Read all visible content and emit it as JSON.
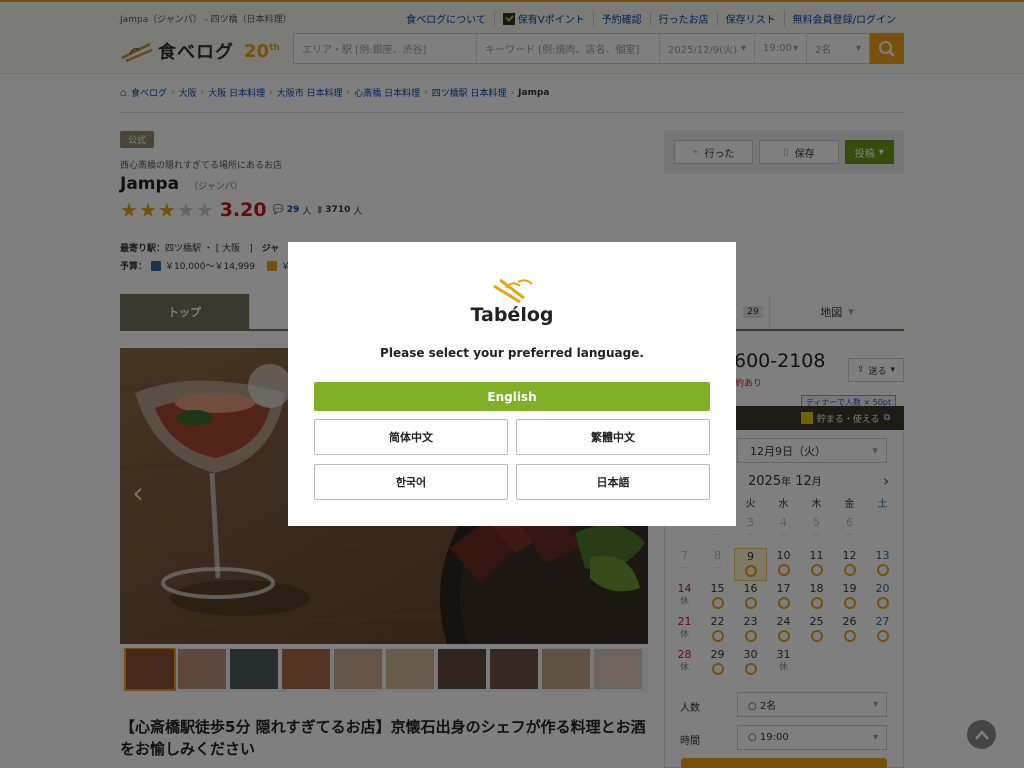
{
  "header": {
    "tagline": "Jampa（ジャンパ） - 四ツ橋（日本料理）",
    "links": [
      "食べログについて",
      "保有Vポイント",
      "予約確認",
      "行ったお店",
      "保存リスト",
      "無料会員登録/ログイン"
    ],
    "logo_text": "食べログ",
    "anniv": "20",
    "anniv_suffix": "th",
    "search": {
      "area_placeholder": "エリア・駅 [例:銀座、渋谷]",
      "keyword_placeholder": "キーワード [例:焼肉、店名、個室]",
      "date": "2025/12/9(火)",
      "time": "19:00",
      "people": "2名"
    }
  },
  "breadcrumb": [
    "食べログ",
    "大阪",
    "大阪 日本料理",
    "大阪市 日本料理",
    "心斎橋 日本料理",
    "四ツ橋駅 日本料理",
    "Jampa"
  ],
  "shop": {
    "official": "公式",
    "catch": "西心斎橋の隠れすぎてる場所にあるお店",
    "name": "Jampa",
    "kana": "（ジャンパ）",
    "rating": "3.20",
    "rating_stars": 3,
    "reviews": "29",
    "reviews_unit": "人",
    "saves": "3710",
    "saves_unit": "人",
    "station_label": "最寄り駅：",
    "station": "四ツ橋駅",
    "station_area": "[ 大阪　]",
    "genre_label": "ジャ",
    "budget_label": "予算：",
    "budget_dinner": "￥10,000～￥14,999",
    "budget_lunch": "￥1"
  },
  "actions": {
    "went": "行った",
    "save": "保存",
    "post": "投稿"
  },
  "tabs": {
    "top": "トップ",
    "count": "29",
    "map": "地図"
  },
  "lead_title": "【心斎橋駅徒歩5分 隠れすぎてるお店】京懐石出身のシェフが作る料理とお酒をお愉しみください",
  "reservation": {
    "phone": "600-2108",
    "send": "送る",
    "note": "約あり",
    "points_badge": "ディナーで人数 × 50pt",
    "vbar_label": "貯まる・使える",
    "date_select": "12月9日（火）",
    "month_year": "2025",
    "month_year_unit": "年",
    "month": "12",
    "month_unit": "月",
    "weekdays": [
      "月",
      "火",
      "水",
      "木",
      "金",
      "土"
    ],
    "rows": [
      [
        {
          "d": "",
          "m": ""
        },
        {
          "d": "2",
          "m": "－"
        },
        {
          "d": "3",
          "m": "－"
        },
        {
          "d": "4",
          "m": "－"
        },
        {
          "d": "5",
          "m": "－"
        },
        {
          "d": "6",
          "m": "－"
        }
      ],
      [
        {
          "d": "7",
          "m": "－"
        },
        {
          "d": "8",
          "m": "－"
        },
        {
          "d": "9",
          "m": "o"
        },
        {
          "d": "10",
          "m": "o"
        },
        {
          "d": "11",
          "m": "o"
        },
        {
          "d": "12",
          "m": "o"
        },
        {
          "d": "13",
          "m": "o"
        }
      ],
      [
        {
          "d": "14",
          "m": "休"
        },
        {
          "d": "15",
          "m": "o"
        },
        {
          "d": "16",
          "m": "o"
        },
        {
          "d": "17",
          "m": "o"
        },
        {
          "d": "18",
          "m": "o"
        },
        {
          "d": "19",
          "m": "o"
        },
        {
          "d": "20",
          "m": "o"
        }
      ],
      [
        {
          "d": "21",
          "m": "休"
        },
        {
          "d": "22",
          "m": "o"
        },
        {
          "d": "23",
          "m": "o"
        },
        {
          "d": "24",
          "m": "o"
        },
        {
          "d": "25",
          "m": "o"
        },
        {
          "d": "26",
          "m": "o"
        },
        {
          "d": "27",
          "m": "o"
        }
      ],
      [
        {
          "d": "28",
          "m": "休"
        },
        {
          "d": "29",
          "m": "o"
        },
        {
          "d": "30",
          "m": "o"
        },
        {
          "d": "31",
          "m": "休"
        }
      ]
    ],
    "people_label": "人数",
    "people_value": "○ 2名",
    "time_label": "時間",
    "time_value": "○ 19:00"
  },
  "modal": {
    "brand": "Tabélog",
    "prompt": "Please select your preferred language.",
    "english": "English",
    "simplified": "简体中文",
    "traditional": "繁體中文",
    "korean": "한국어",
    "japanese": "日本語"
  },
  "colors": {
    "brand_orange": "#f0a21a",
    "tab_active": "#77705a",
    "english_button": "#80af28",
    "score_red": "#c8161d"
  }
}
